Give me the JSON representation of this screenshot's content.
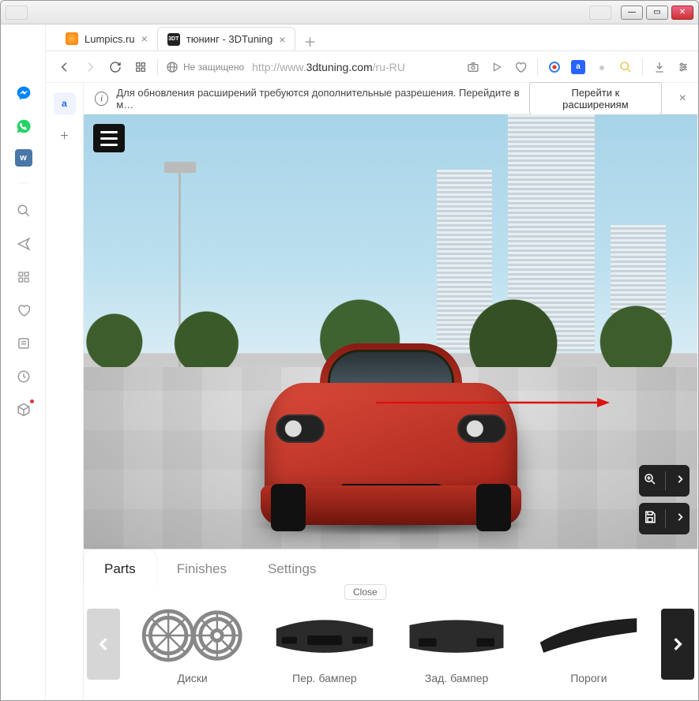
{
  "tabs": [
    {
      "title": "Lumpics.ru",
      "favicon": "orange"
    },
    {
      "title": "тюнинг - 3DTuning",
      "favicon": "dark",
      "favicon_text": "3DT"
    }
  ],
  "active_tab_index": 1,
  "addressbar": {
    "security_label": "Не защищено",
    "url_prefix": "http://www.",
    "url_host": "3dtuning.com",
    "url_path": "/ru-RU"
  },
  "notice": {
    "text": "Для обновления расширений требуются дополнительные разрешения. Перейдите в м…",
    "button": "Перейти к расширениям"
  },
  "mini_tab_label": "a",
  "hamburger_name": "menu",
  "zoom_control": {
    "zoom_icon": "zoom-in",
    "expand_icon": "chevron-right"
  },
  "save_control": {
    "save_icon": "floppy",
    "expand_icon": "chevron-right"
  },
  "bottom_tabs": {
    "items": [
      "Parts",
      "Finishes",
      "Settings"
    ],
    "active": 0,
    "close_label": "Close"
  },
  "parts": [
    {
      "label": "Диски"
    },
    {
      "label": "Пер. бампер"
    },
    {
      "label": "Зад. бампер"
    },
    {
      "label": "Пороги"
    }
  ]
}
